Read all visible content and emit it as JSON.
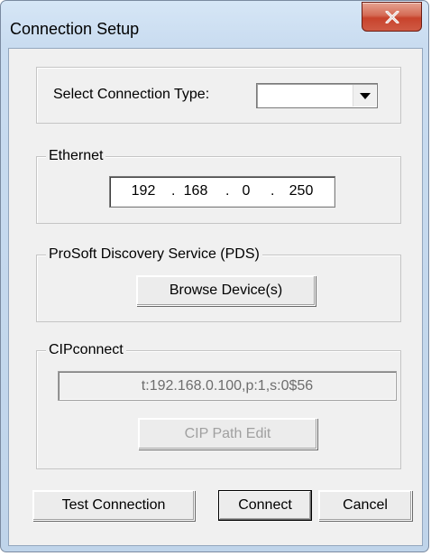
{
  "window": {
    "title": "Connection Setup"
  },
  "connection_type": {
    "label": "Select Connection Type:",
    "selected_value": ""
  },
  "ethernet": {
    "group_label": "Ethernet",
    "ip_octets": [
      "192",
      "168",
      "0",
      "250"
    ],
    "separator": "."
  },
  "pds": {
    "group_label": "ProSoft Discovery Service (PDS)",
    "browse_label": "Browse Device(s)"
  },
  "cipconnect": {
    "group_label": "CIPconnect",
    "path_value": "t:192.168.0.100,p:1,s:0$56",
    "edit_label": "CIP Path Edit"
  },
  "buttons": {
    "test_connection": "Test Connection",
    "connect": "Connect",
    "cancel": "Cancel"
  },
  "colors": {
    "close_button": "#c8432c",
    "dialog_bg": "#f0f0f0",
    "disabled_text": "#a0a0a0"
  }
}
